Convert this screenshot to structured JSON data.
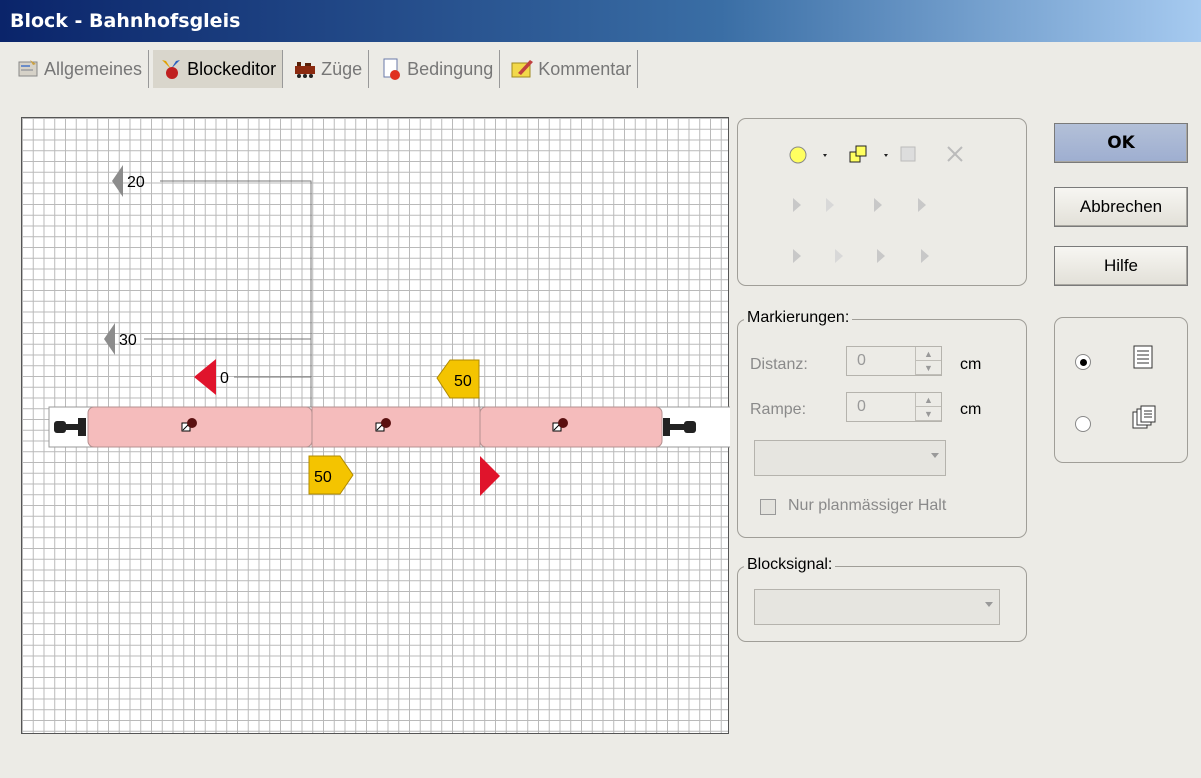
{
  "window": {
    "title": "Block - Bahnhofsgleis"
  },
  "tabs": [
    {
      "label": "Allgemeines",
      "icon": "general-icon"
    },
    {
      "label": "Blockeditor",
      "icon": "block-editor-icon"
    },
    {
      "label": "Züge",
      "icon": "trains-icon"
    },
    {
      "label": "Bedingung",
      "icon": "condition-icon"
    },
    {
      "label": "Kommentar",
      "icon": "comment-icon"
    }
  ],
  "editor": {
    "markers": {
      "gray_top": "20",
      "gray_mid": "30",
      "red_left": "0",
      "yellow_upper": "50",
      "yellow_lower": "50"
    },
    "colors": {
      "track": "#f5bcbc",
      "red_marker": "#e0142c",
      "yellow_marker": "#f4c400",
      "gray_marker": "#8c8c8c"
    }
  },
  "markierungen": {
    "legend": "Markierungen:",
    "distanz_label": "Distanz:",
    "distanz_value": "0",
    "rampe_label": "Rampe:",
    "rampe_value": "0",
    "unit": "cm",
    "checkbox_label": "Nur planmässiger Halt"
  },
  "blocksignal": {
    "legend": "Blocksignal:"
  },
  "buttons": {
    "ok": "OK",
    "cancel": "Abbrechen",
    "help": "Hilfe"
  }
}
